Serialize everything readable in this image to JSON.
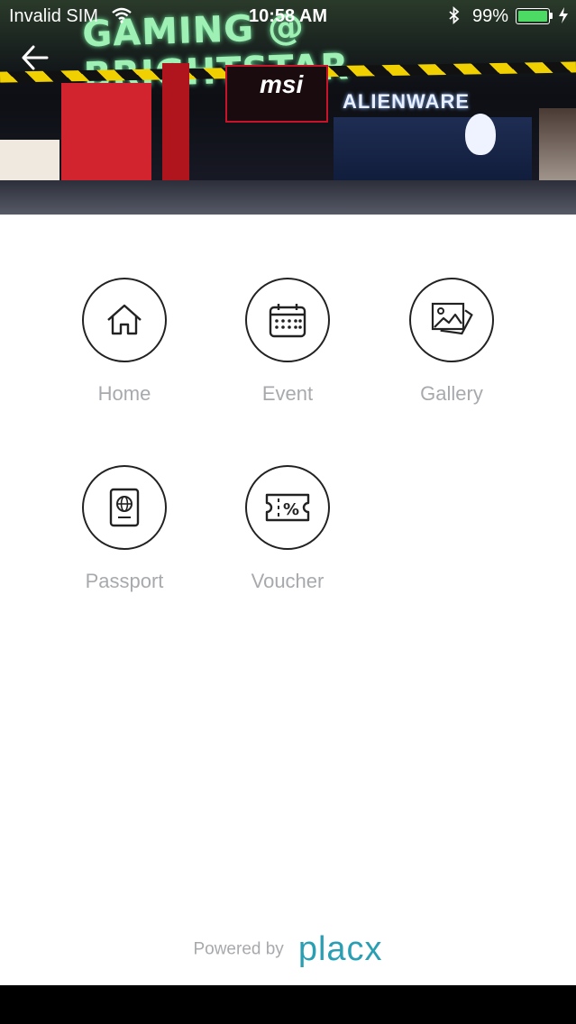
{
  "status_bar": {
    "carrier": "Invalid SIM",
    "time": "10:58 AM",
    "battery_percent_text": "99%",
    "battery_level": 0.99
  },
  "header": {
    "store_sign": "GAMING @ BRIGHTSTAR",
    "brand_sign_1": "msi",
    "brand_sign_2": "ALIENWARE"
  },
  "menu": {
    "items": [
      {
        "label": "Home",
        "icon": "home-icon"
      },
      {
        "label": "Event",
        "icon": "calendar-icon"
      },
      {
        "label": "Gallery",
        "icon": "gallery-icon"
      },
      {
        "label": "Passport",
        "icon": "passport-icon"
      },
      {
        "label": "Voucher",
        "icon": "voucher-icon"
      }
    ]
  },
  "footer": {
    "powered_by": "Powered by",
    "brand": "placx"
  },
  "colors": {
    "label": "#a7a9ac",
    "brand": "#2a9fb3",
    "icon_stroke": "#222222"
  }
}
